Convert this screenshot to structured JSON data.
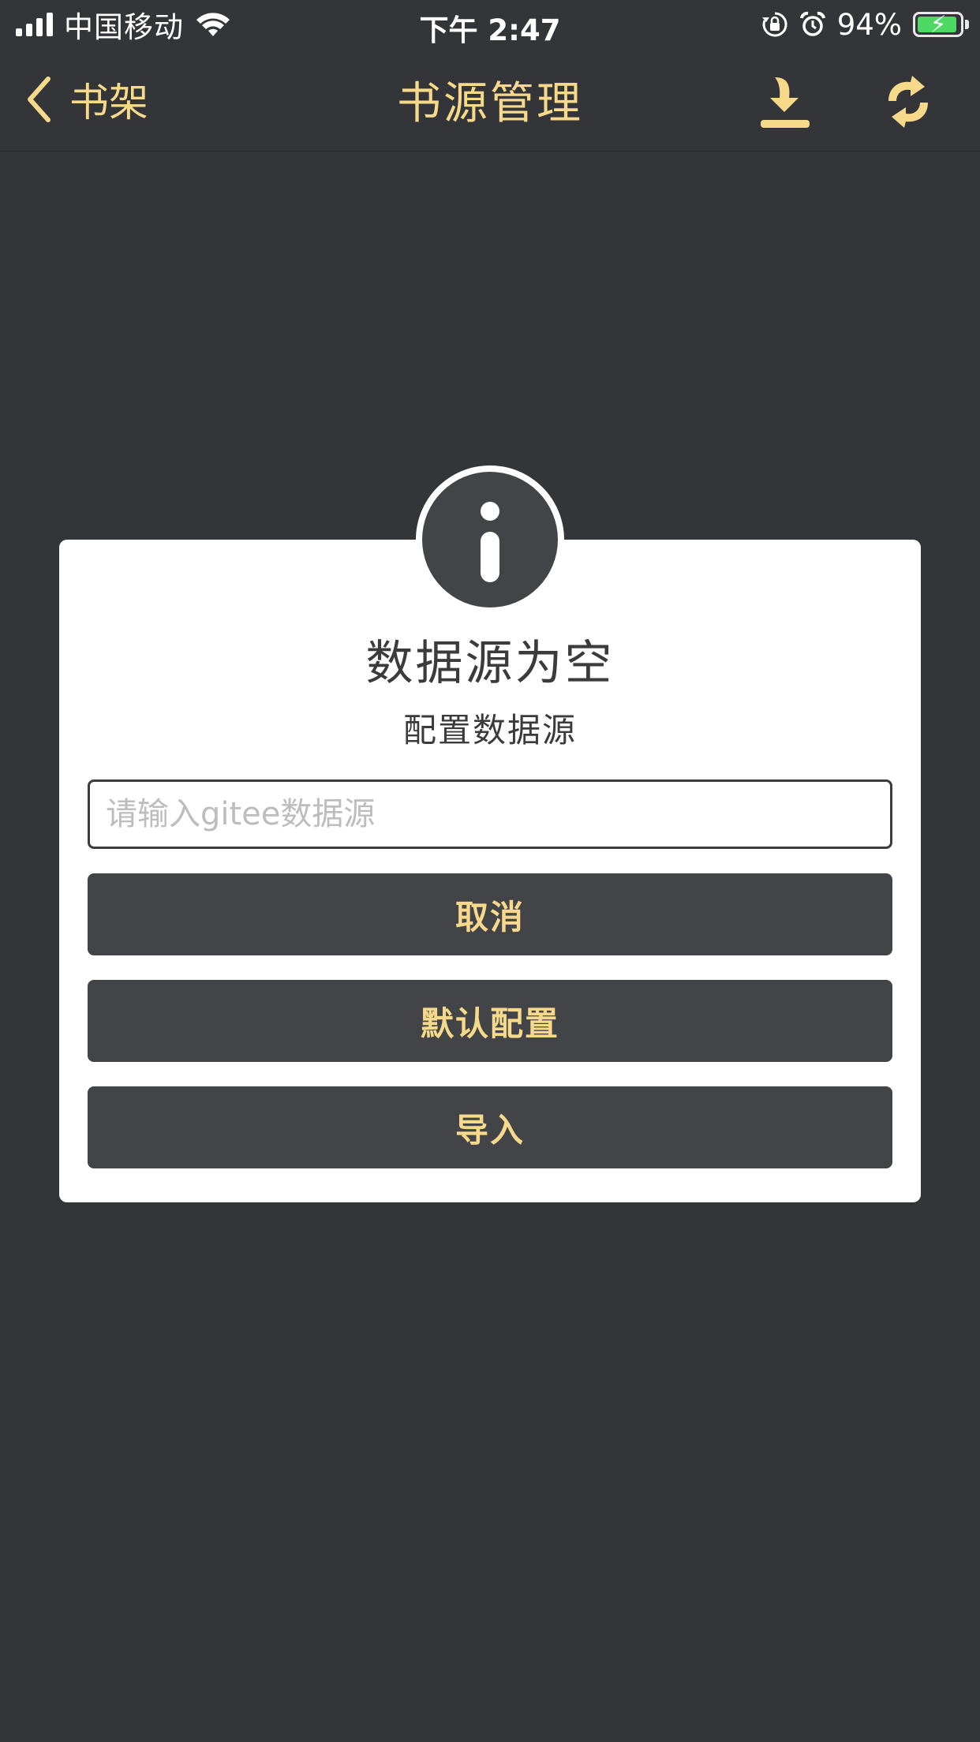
{
  "status_bar": {
    "carrier": "中国移动",
    "time": "下午 2:47",
    "battery_percent": "94%",
    "battery_level": 0.94
  },
  "nav": {
    "back_label": "书架",
    "title": "书源管理",
    "download_icon": "download-icon",
    "refresh_icon": "refresh-icon"
  },
  "dialog": {
    "icon": "info-icon",
    "title": "数据源为空",
    "subtitle": "配置数据源",
    "input": {
      "value": "",
      "placeholder": "请输入gitee数据源"
    },
    "buttons": {
      "cancel": "取消",
      "default_config": "默认配置",
      "import": "导入"
    }
  },
  "colors": {
    "background": "#343538",
    "accent": "#f6d98a",
    "dialog_button": "#434447",
    "battery_fill": "#4cd964"
  }
}
